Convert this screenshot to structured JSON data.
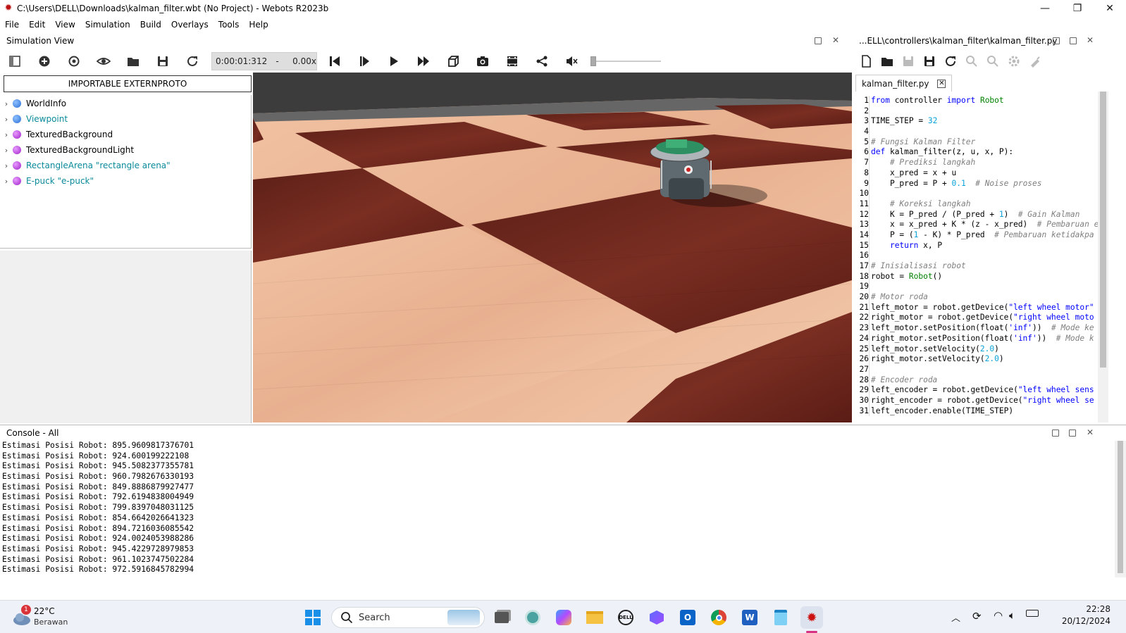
{
  "window": {
    "title": "C:\\Users\\DELL\\Downloads\\kalman_filter.wbt (No Project) - Webots R2023b",
    "minimize": "—",
    "maximize": "❐",
    "close": "✕"
  },
  "menu": [
    "File",
    "Edit",
    "View",
    "Simulation",
    "Build",
    "Overlays",
    "Tools",
    "Help"
  ],
  "simulation_view": {
    "title": "Simulation View",
    "time": "0:00:01:312",
    "speed_sep": "-",
    "speed": "0.00x"
  },
  "scene_tree": {
    "button": "IMPORTABLE EXTERNPROTO",
    "nodes": [
      {
        "label": "WorldInfo",
        "color": "#2a6fd6",
        "teal": false
      },
      {
        "label": "Viewpoint",
        "color": "#2a6fd6",
        "teal": true
      },
      {
        "label": "TexturedBackground",
        "color": "#a020c8",
        "teal": false
      },
      {
        "label": "TexturedBackgroundLight",
        "color": "#a020c8",
        "teal": false
      },
      {
        "label": "RectangleArena \"rectangle arena\"",
        "color": "#a020c8",
        "teal": true
      },
      {
        "label": "E-puck \"e-puck\"",
        "color": "#a020c8",
        "teal": true
      }
    ]
  },
  "editor": {
    "path": "...ELL\\controllers\\kalman_filter\\kalman_filter.py",
    "tab": "kalman_filter.py",
    "tab_close": "✕",
    "lines": [
      [
        [
          "kw",
          "from"
        ],
        [
          "t",
          " controller "
        ],
        [
          "kw",
          "import"
        ],
        [
          "t",
          " "
        ],
        [
          "fn",
          "Robot"
        ]
      ],
      [],
      [
        [
          "t",
          "TIME_STEP = "
        ],
        [
          "num",
          "32"
        ]
      ],
      [],
      [
        [
          "cm",
          "# Fungsi Kalman Filter"
        ]
      ],
      [
        [
          "kw",
          "def"
        ],
        [
          "t",
          " kalman_filter(z, u, x, P):"
        ]
      ],
      [
        [
          "t",
          "    "
        ],
        [
          "cm",
          "# Prediksi langkah"
        ]
      ],
      [
        [
          "t",
          "    x_pred = x + u"
        ]
      ],
      [
        [
          "t",
          "    P_pred = P + "
        ],
        [
          "num",
          "0.1"
        ],
        [
          "t",
          "  "
        ],
        [
          "cm",
          "# Noise proses"
        ]
      ],
      [],
      [
        [
          "t",
          "    "
        ],
        [
          "cm",
          "# Koreksi langkah"
        ]
      ],
      [
        [
          "t",
          "    K = P_pred / (P_pred + "
        ],
        [
          "num",
          "1"
        ],
        [
          "t",
          ")  "
        ],
        [
          "cm",
          "# Gain Kalman"
        ]
      ],
      [
        [
          "t",
          "    x = x_pred + K * (z - x_pred)  "
        ],
        [
          "cm",
          "# Pembaruan e"
        ]
      ],
      [
        [
          "t",
          "    P = ("
        ],
        [
          "num",
          "1"
        ],
        [
          "t",
          " - K) * P_pred  "
        ],
        [
          "cm",
          "# Pembaruan ketidakpa"
        ]
      ],
      [
        [
          "t",
          "    "
        ],
        [
          "kw",
          "return"
        ],
        [
          "t",
          " x, P"
        ]
      ],
      [],
      [
        [
          "cm",
          "# Inisialisasi robot"
        ]
      ],
      [
        [
          "t",
          "robot = "
        ],
        [
          "fn",
          "Robot"
        ],
        [
          "t",
          "()"
        ]
      ],
      [],
      [
        [
          "cm",
          "# Motor roda"
        ]
      ],
      [
        [
          "t",
          "left_motor = robot.getDevice("
        ],
        [
          "str",
          "\"left wheel motor\""
        ]
      ],
      [
        [
          "t",
          "right_motor = robot.getDevice("
        ],
        [
          "str",
          "\"right wheel moto"
        ]
      ],
      [
        [
          "t",
          "left_motor.setPosition(float("
        ],
        [
          "str",
          "'inf'"
        ],
        [
          "t",
          "))  "
        ],
        [
          "cm",
          "# Mode ke"
        ]
      ],
      [
        [
          "t",
          "right_motor.setPosition(float("
        ],
        [
          "str",
          "'inf'"
        ],
        [
          "t",
          "))  "
        ],
        [
          "cm",
          "# Mode k"
        ]
      ],
      [
        [
          "t",
          "left_motor.setVelocity("
        ],
        [
          "num",
          "2.0"
        ],
        [
          "t",
          ")"
        ]
      ],
      [
        [
          "t",
          "right_motor.setVelocity("
        ],
        [
          "num",
          "2.0"
        ],
        [
          "t",
          ")"
        ]
      ],
      [],
      [
        [
          "cm",
          "# Encoder roda"
        ]
      ],
      [
        [
          "t",
          "left_encoder = robot.getDevice("
        ],
        [
          "str",
          "\"left wheel sens"
        ]
      ],
      [
        [
          "t",
          "right_encoder = robot.getDevice("
        ],
        [
          "str",
          "\"right wheel se"
        ]
      ],
      [
        [
          "t",
          "left_encoder.enable(TIME_STEP)"
        ]
      ]
    ]
  },
  "console": {
    "title": "Console - All",
    "lines": [
      "Estimasi Posisi Robot: 895.9609817376701",
      "Estimasi Posisi Robot: 924.600199222108",
      "Estimasi Posisi Robot: 945.5082377355781",
      "Estimasi Posisi Robot: 960.7982676330193",
      "Estimasi Posisi Robot: 849.8886879927477",
      "Estimasi Posisi Robot: 792.6194838004949",
      "Estimasi Posisi Robot: 799.8397048031125",
      "Estimasi Posisi Robot: 854.6642026641323",
      "Estimasi Posisi Robot: 894.7216036085542",
      "Estimasi Posisi Robot: 924.0024053988286",
      "Estimasi Posisi Robot: 945.4229728979853",
      "Estimasi Posisi Robot: 961.1023747502284",
      "Estimasi Posisi Robot: 972.5916845782994"
    ]
  },
  "taskbar": {
    "weather_temp": "22°C",
    "weather_desc": "Berawan",
    "weather_badge": "1",
    "search": "Search",
    "time": "22:28",
    "date": "20/12/2024"
  },
  "colors": {
    "keyword": "#0000ff",
    "builtin": "#008000",
    "number": "#09a2d9",
    "string": "#0000ff",
    "comment": "#808080",
    "teal_node": "#0a8a9a"
  }
}
